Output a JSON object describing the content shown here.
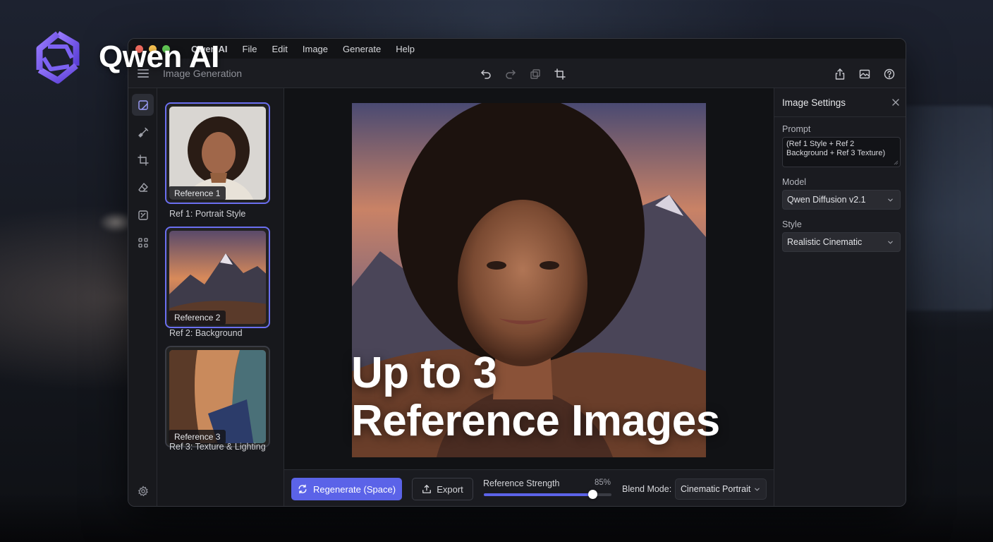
{
  "brand": {
    "name": "Qwen AI",
    "accent": "#7b5cf0"
  },
  "menubar": {
    "app_name": "Qwen AI",
    "items": [
      "File",
      "Edit",
      "Image",
      "Generate",
      "Help"
    ]
  },
  "toolbar": {
    "title": "Image Generation",
    "center_icons": [
      "undo-icon",
      "redo-icon",
      "duplicate-icon",
      "crop-icon"
    ],
    "right_icons": [
      "share-icon",
      "gallery-icon",
      "help-icon"
    ]
  },
  "tool_rail": {
    "items": [
      "canvas-icon",
      "brush-icon",
      "crop-icon",
      "eraser-icon",
      "image-adjust-icon",
      "grid-icon"
    ],
    "footer": "settings-gear-icon",
    "active_index": 0
  },
  "references": [
    {
      "tag": "Reference 1",
      "caption": "Ref 1: Portrait Style",
      "selected": true
    },
    {
      "tag": "Reference 2",
      "caption": "Ref 2: Background",
      "selected": true
    },
    {
      "tag": "Reference 3",
      "caption": "Ref 3: Texture & Lighting",
      "selected": false
    }
  ],
  "canvas": {
    "overlay_line1": "Up to 3",
    "overlay_line2": "Reference Images"
  },
  "bottom_bar": {
    "regenerate_label": "Regenerate (Space)",
    "export_label": "Export",
    "strength_label": "Reference Strength",
    "strength_value": "85%",
    "strength_fraction": 0.85,
    "blend_label": "Blend Mode:",
    "blend_value": "Cinematic Portrait"
  },
  "settings": {
    "title": "Image Settings",
    "prompt_label": "Prompt",
    "prompt_value": "(Ref 1 Style + Ref 2 Background + Ref 3 Texture)",
    "model_label": "Model",
    "model_value": "Qwen Diffusion v2.1",
    "style_label": "Style",
    "style_value": "Realistic Cinematic"
  },
  "colors": {
    "primary": "#5b63e8",
    "selected_border": "#6b6ff0",
    "window_bg": "#16171b"
  }
}
